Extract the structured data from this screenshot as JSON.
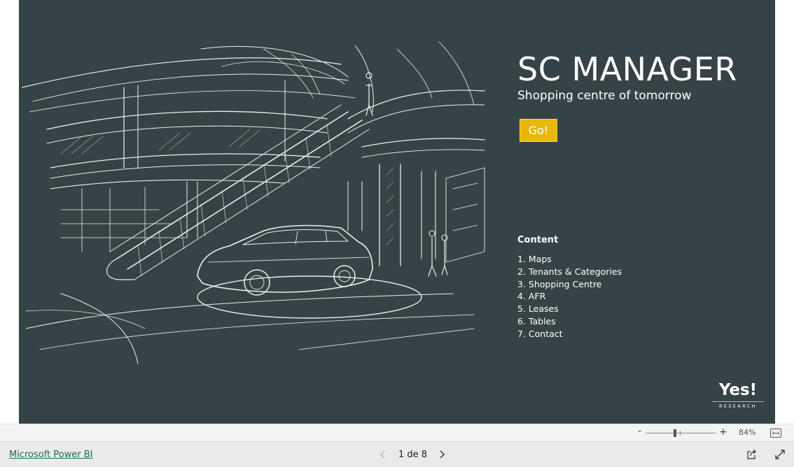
{
  "report": {
    "title": "SC MANAGER",
    "subtitle": "Shopping centre of tomorrow",
    "go_button": "Go!",
    "content_heading": "Content",
    "content_items": [
      "1. Maps",
      "2. Tenants & Categories",
      "3. Shopping Centre",
      "4. AFR",
      "5. Leases",
      "6. Tables",
      "7. Contact"
    ],
    "logo": {
      "main": "Yes!",
      "sub": "RESEARCH"
    },
    "colors": {
      "background": "#364346",
      "accent": "#eab60a",
      "text": "#ffffff"
    }
  },
  "zoom": {
    "minus_label": "-",
    "plus_label": "+",
    "value": "84%",
    "level_percent": 84
  },
  "footer": {
    "powerbi_link": "Microsoft Power BI",
    "page_indicator": "1 de 8"
  },
  "icons": {
    "prev": "chevron-left-icon",
    "next": "chevron-right-icon",
    "share": "share-icon",
    "fullscreen": "expand-icon",
    "fit": "fit-to-page-icon"
  }
}
